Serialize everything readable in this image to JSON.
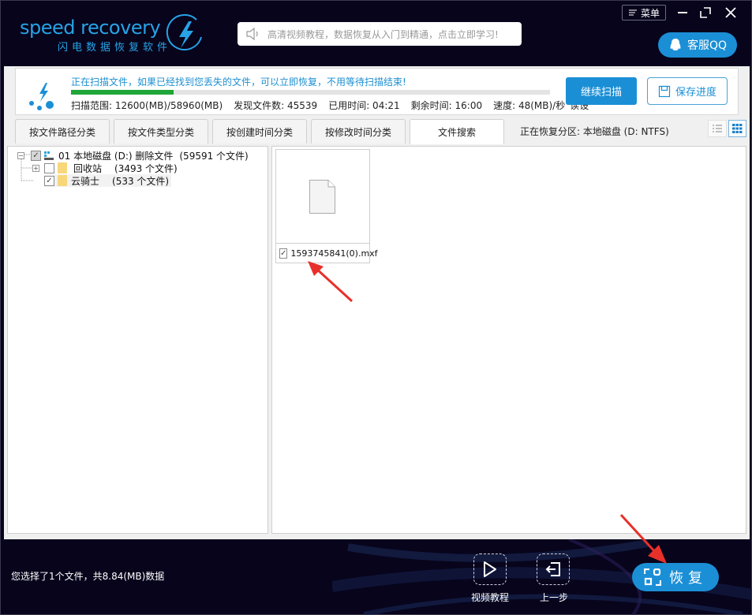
{
  "header": {
    "logo_text": "speed recovery",
    "logo_subtitle": "闪电数据恢复软件",
    "notice": "高清视频教程，数据恢复从入门到精通，点击立即学习!",
    "menu_label": "菜单",
    "qq_label": "客服QQ"
  },
  "scan": {
    "message": "正在扫描文件，如果已经找到您丢失的文件，可以立即恢复，不用等待扫描结束!",
    "progress_fraction": 0.2137,
    "range": "扫描范围: 12600(MB)/58960(MB)",
    "found": "发现文件数: 45539",
    "elapsed": "已用时间: 04:21",
    "remaining": "剩余时间: 16:00",
    "speed": "速度: 48(MB)/秒",
    "status": "读设",
    "continue_label": "继续扫描",
    "save_label": "保存进度"
  },
  "tabs": [
    {
      "label": "按文件路径分类",
      "active": false
    },
    {
      "label": "按文件类型分类",
      "active": false
    },
    {
      "label": "按创建时间分类",
      "active": false
    },
    {
      "label": "按修改时间分类",
      "active": false
    },
    {
      "label": "文件搜索",
      "active": true
    }
  ],
  "partition": "正在恢复分区: 本地磁盘 (D: NTFS)",
  "tree": {
    "root": {
      "label": "01 本地磁盘 (D:) 删除文件",
      "count": "(59591 个文件)"
    },
    "children": [
      {
        "label": "回收站",
        "count": "(3493 个文件)",
        "checked": false
      },
      {
        "label": "云骑士",
        "count": "(533 个文件)",
        "checked": true
      }
    ]
  },
  "files": [
    {
      "name": "1593745841(0).mxf",
      "checked": true
    }
  ],
  "footer": {
    "selection_info": "您选择了1个文件，共8.84(MB)数据",
    "video_label": "视频教程",
    "back_label": "上一步",
    "recover_label": "恢复"
  },
  "colors": {
    "accent": "#1b8fd6",
    "progress": "#1fa538",
    "background": "#07041c",
    "annotation_arrow": "#e8302a"
  }
}
